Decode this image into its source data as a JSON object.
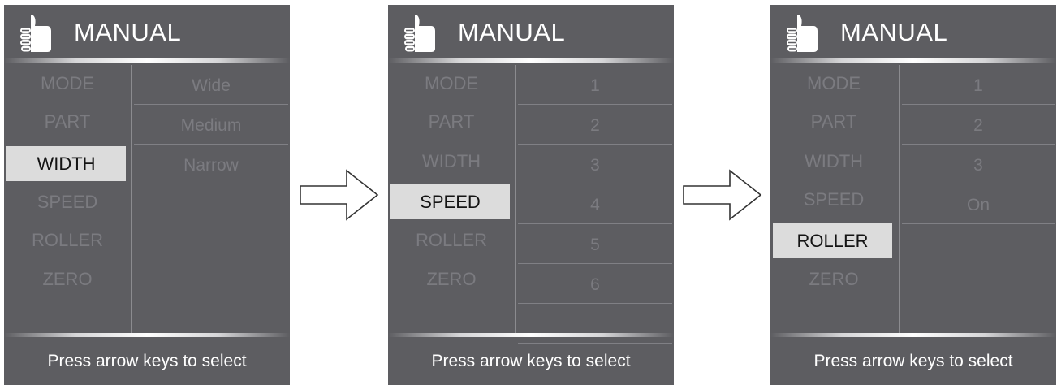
{
  "panels": [
    {
      "title": "MANUAL",
      "menu": [
        "MODE",
        "PART",
        "WIDTH",
        "SPEED",
        "ROLLER",
        "ZERO"
      ],
      "selected": "WIDTH",
      "options": [
        "Wide",
        "Medium",
        "Narrow"
      ],
      "footer": "Press arrow keys to select"
    },
    {
      "title": "MANUAL",
      "menu": [
        "MODE",
        "PART",
        "WIDTH",
        "SPEED",
        "ROLLER",
        "ZERO"
      ],
      "selected": "SPEED",
      "options": [
        "1",
        "2",
        "3",
        "4",
        "5",
        "6",
        ""
      ],
      "footer": "Press arrow keys to select"
    },
    {
      "title": "MANUAL",
      "menu": [
        "MODE",
        "PART",
        "WIDTH",
        "SPEED",
        "ROLLER",
        "ZERO"
      ],
      "selected": "ROLLER",
      "options": [
        "1",
        "2",
        "3",
        "On"
      ],
      "footer": "Press arrow keys to select"
    }
  ],
  "icons": {
    "header": "thumbs-up-icon",
    "transition": "right-arrow-icon"
  },
  "colors": {
    "panel_bg": "#5d5d61",
    "selected_bg": "#dcdcdc",
    "dim_text": "#7b7b80",
    "title_text": "#ffffff"
  }
}
